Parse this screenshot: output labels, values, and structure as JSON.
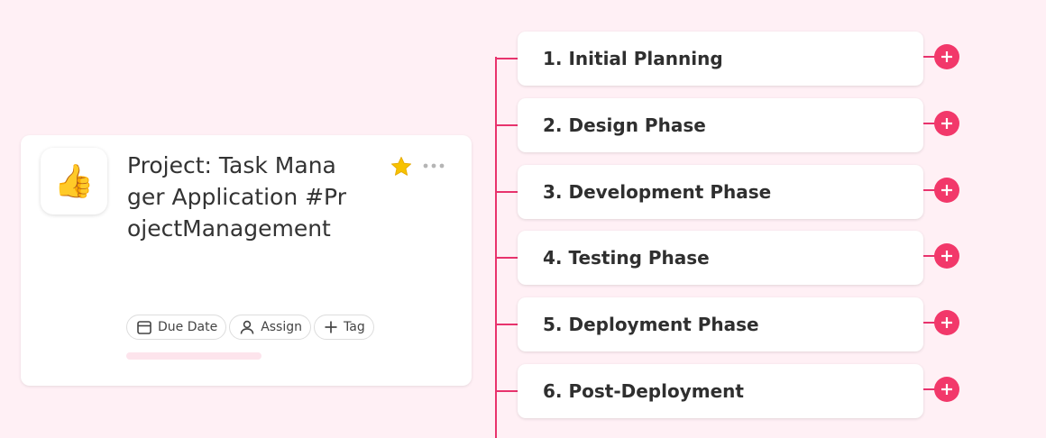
{
  "project": {
    "icon": "thumbs-up-emoji",
    "emoji": "👍",
    "title": "Project: Task Manager Application #ProjectManagement",
    "starred": true,
    "chips": {
      "due_date": "Due Date",
      "assign": "Assign",
      "tag": "Tag"
    },
    "progress": 0
  },
  "phases": [
    {
      "label": "1. Initial Planning"
    },
    {
      "label": "2. Design Phase"
    },
    {
      "label": "3. Development Phase"
    },
    {
      "label": "4. Testing Phase"
    },
    {
      "label": "5. Deployment Phase"
    },
    {
      "label": "6. Post-Deployment"
    }
  ],
  "colors": {
    "background": "#fff0f5",
    "accent": "#f2386a",
    "star": "#f7c200"
  }
}
